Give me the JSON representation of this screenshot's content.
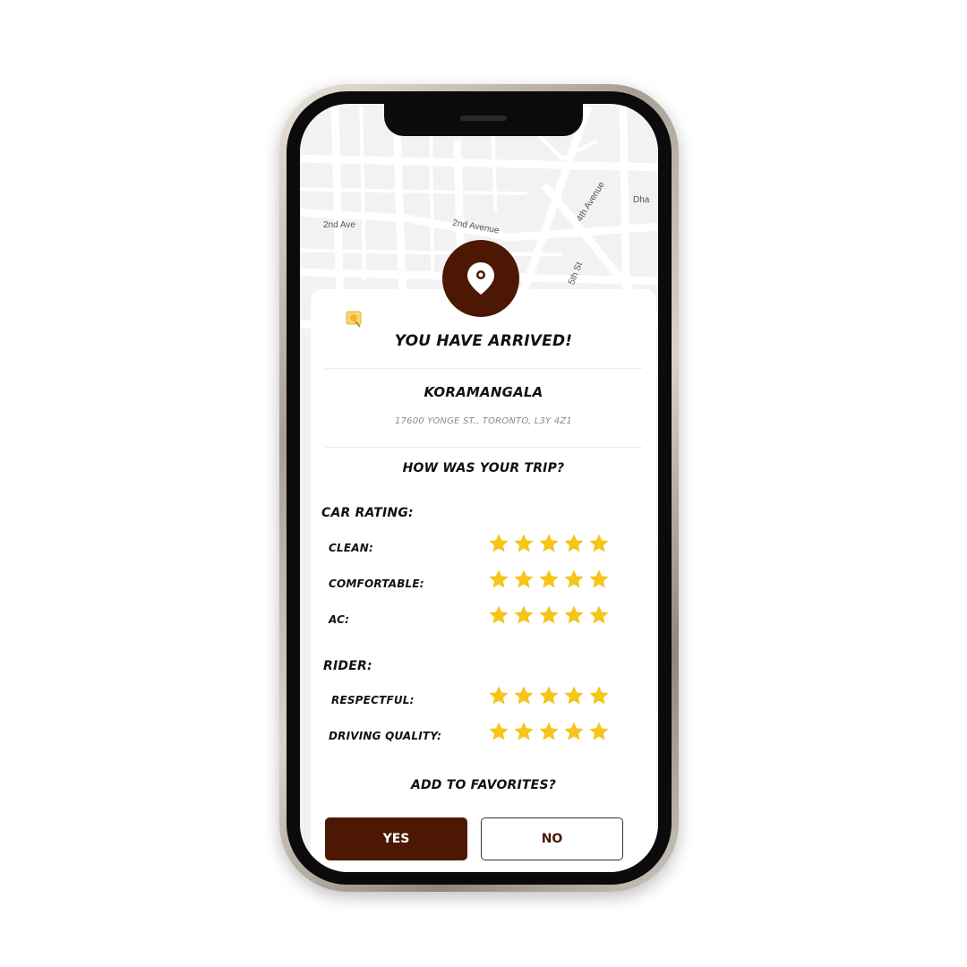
{
  "map": {
    "labels": [
      "2nd Ave",
      "2nd Avenue",
      "4th Avenue",
      "5th St",
      "Dha"
    ]
  },
  "card": {
    "title": "YOU HAVE ARRIVED!",
    "place_name": "KORAMANGALA",
    "address": "17600 YONGE ST., TORONTO, L3Y 4Z1",
    "trip_question": "HOW WAS YOUR TRIP?",
    "car_section_label": "CAR RATING:",
    "car_ratings": [
      {
        "label": "CLEAN:",
        "stars": 5
      },
      {
        "label": "COMFORTABLE:",
        "stars": 5
      },
      {
        "label": "AC:",
        "stars": 5
      }
    ],
    "rider_section_label": "RIDER:",
    "rider_ratings": [
      {
        "label": "RESPECTFUL:",
        "stars": 5
      },
      {
        "label": "DRIVING QUALITY:",
        "stars": 5
      }
    ],
    "favorites_question": "ADD TO FAVORITES?",
    "yes_label": "YES",
    "no_label": "NO"
  },
  "colors": {
    "brand": "#4c1803",
    "star": "#f5c518"
  },
  "icons": {
    "pin": "location-pin-icon",
    "badge": "map-badge-icon",
    "star": "star-icon"
  }
}
